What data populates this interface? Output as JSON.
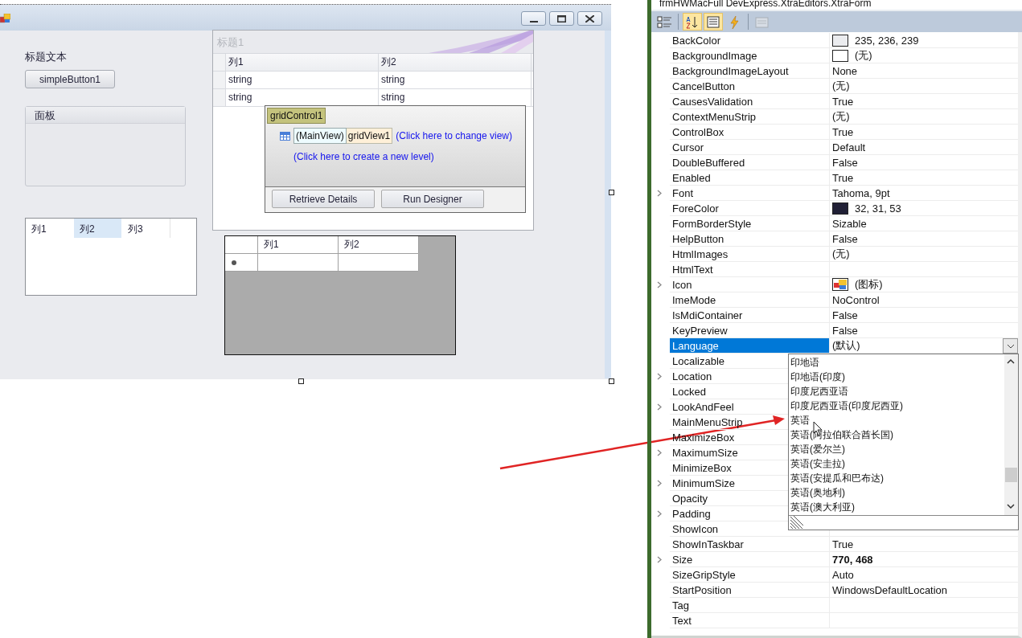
{
  "designer": {
    "window_buttons": [
      {
        "kind": "minimize"
      },
      {
        "kind": "maximize"
      },
      {
        "kind": "close"
      }
    ],
    "label": "标题文本",
    "button": "simpleButton1",
    "group_panel": {
      "caption": "面板"
    },
    "list_view": {
      "columns": [
        {
          "label": "列1",
          "selected": false
        },
        {
          "label": "列2",
          "selected": true
        },
        {
          "label": "列3",
          "selected": false
        }
      ]
    },
    "grid_control": {
      "caption": "标题1",
      "columns": [
        "列1",
        "列2"
      ],
      "rows": [
        [
          "string",
          "string"
        ],
        [
          "string",
          "string"
        ]
      ],
      "designer_panel": {
        "control_name": "gridControl1",
        "main_view": "(MainView)",
        "view_name": "gridView1",
        "change_view_link": "(Click here to change view)",
        "new_level_link": "(Click here to create a new level)",
        "buttons": [
          "Retrieve Details",
          "Run Designer"
        ]
      }
    },
    "data_grid_view": {
      "columns": [
        "列1",
        "列2"
      ]
    }
  },
  "properties": {
    "header": "frmHWMacFull  DevExpress.XtraEditors.XtraForm",
    "toolbar": [
      {
        "kind": "categorized",
        "selected": false,
        "disabled": false
      },
      {
        "kind": "alphabetical",
        "selected": true,
        "disabled": false
      },
      {
        "kind": "properties",
        "selected": true,
        "disabled": false
      },
      {
        "kind": "events",
        "selected": false,
        "disabled": false
      },
      {
        "kind": "pages",
        "selected": false,
        "disabled": true
      }
    ],
    "rows": [
      {
        "name": "BackColor",
        "value": "235, 236, 239",
        "kind": "color",
        "color": "#ebecef",
        "expandable": false,
        "selected": false,
        "modified": false
      },
      {
        "name": "BackgroundImage",
        "value": "(无)",
        "kind": "image",
        "expandable": false,
        "selected": false,
        "modified": false
      },
      {
        "name": "BackgroundImageLayout",
        "value": "None",
        "expandable": false,
        "selected": false,
        "modified": false
      },
      {
        "name": "CancelButton",
        "value": "(无)",
        "expandable": false,
        "selected": false,
        "modified": false
      },
      {
        "name": "CausesValidation",
        "value": "True",
        "expandable": false,
        "selected": false,
        "modified": false
      },
      {
        "name": "ContextMenuStrip",
        "value": "(无)",
        "expandable": false,
        "selected": false,
        "modified": false
      },
      {
        "name": "ControlBox",
        "value": "True",
        "expandable": false,
        "selected": false,
        "modified": false
      },
      {
        "name": "Cursor",
        "value": "Default",
        "expandable": false,
        "selected": false,
        "modified": false
      },
      {
        "name": "DoubleBuffered",
        "value": "False",
        "expandable": false,
        "selected": false,
        "modified": false
      },
      {
        "name": "Enabled",
        "value": "True",
        "expandable": false,
        "selected": false,
        "modified": false
      },
      {
        "name": "Font",
        "value": "Tahoma, 9pt",
        "expandable": true,
        "selected": false,
        "modified": false
      },
      {
        "name": "ForeColor",
        "value": "32, 31, 53",
        "kind": "color",
        "color": "#201f35",
        "expandable": false,
        "selected": false,
        "modified": false
      },
      {
        "name": "FormBorderStyle",
        "value": "Sizable",
        "expandable": false,
        "selected": false,
        "modified": false
      },
      {
        "name": "HelpButton",
        "value": "False",
        "expandable": false,
        "selected": false,
        "modified": false
      },
      {
        "name": "HtmlImages",
        "value": "(无)",
        "expandable": false,
        "selected": false,
        "modified": false
      },
      {
        "name": "HtmlText",
        "expandable": false,
        "selected": false
      },
      {
        "name": "Icon",
        "value": "(图标)",
        "kind": "icon",
        "expandable": true,
        "selected": false,
        "modified": false
      },
      {
        "name": "ImeMode",
        "value": "NoControl",
        "expandable": false,
        "selected": false,
        "modified": false
      },
      {
        "name": "IsMdiContainer",
        "value": "False",
        "expandable": false,
        "selected": false,
        "modified": false
      },
      {
        "name": "KeyPreview",
        "value": "False",
        "expandable": false,
        "selected": false,
        "modified": false
      },
      {
        "name": "Language",
        "value": "(默认)",
        "kind": "dropdown",
        "expandable": false,
        "selected": true,
        "modified": false
      },
      {
        "name": "Localizable",
        "expandable": false,
        "selected": false
      },
      {
        "name": "Location",
        "expandable": true,
        "selected": false
      },
      {
        "name": "Locked",
        "expandable": false,
        "selected": false
      },
      {
        "name": "LookAndFeel",
        "expandable": true,
        "selected": false
      },
      {
        "name": "MainMenuStrip",
        "expandable": false,
        "selected": false
      },
      {
        "name": "MaximizeBox",
        "expandable": false,
        "selected": false
      },
      {
        "name": "MaximumSize",
        "expandable": true,
        "selected": false
      },
      {
        "name": "MinimizeBox",
        "expandable": false,
        "selected": false
      },
      {
        "name": "MinimumSize",
        "expandable": true,
        "selected": false
      },
      {
        "name": "Opacity",
        "expandable": false,
        "selected": false
      },
      {
        "name": "Padding",
        "expandable": true,
        "selected": false
      },
      {
        "name": "ShowIcon",
        "expandable": false,
        "selected": false
      },
      {
        "name": "ShowInTaskbar",
        "value": "True",
        "expandable": false,
        "selected": false,
        "modified": false
      },
      {
        "name": "Size",
        "value": "770, 468",
        "expandable": true,
        "selected": false,
        "modified": true
      },
      {
        "name": "SizeGripStyle",
        "value": "Auto",
        "expandable": false,
        "selected": false,
        "modified": false
      },
      {
        "name": "StartPosition",
        "value": "WindowsDefaultLocation",
        "expandable": false,
        "selected": false,
        "modified": false
      },
      {
        "name": "Tag",
        "expandable": false,
        "selected": false
      },
      {
        "name": "Text",
        "expandable": false,
        "selected": false
      }
    ],
    "dropdown": {
      "items": [
        "印地语",
        "印地语(印度)",
        "印度尼西亚语",
        "印度尼西亚语(印度尼西亚)",
        "英语",
        "英语(阿拉伯联合酋长国)",
        "英语(爱尔兰)",
        "英语(安圭拉)",
        "英语(安提瓜和巴布达)",
        "英语(奥地利)",
        "英语(澳大利亚)"
      ]
    }
  }
}
